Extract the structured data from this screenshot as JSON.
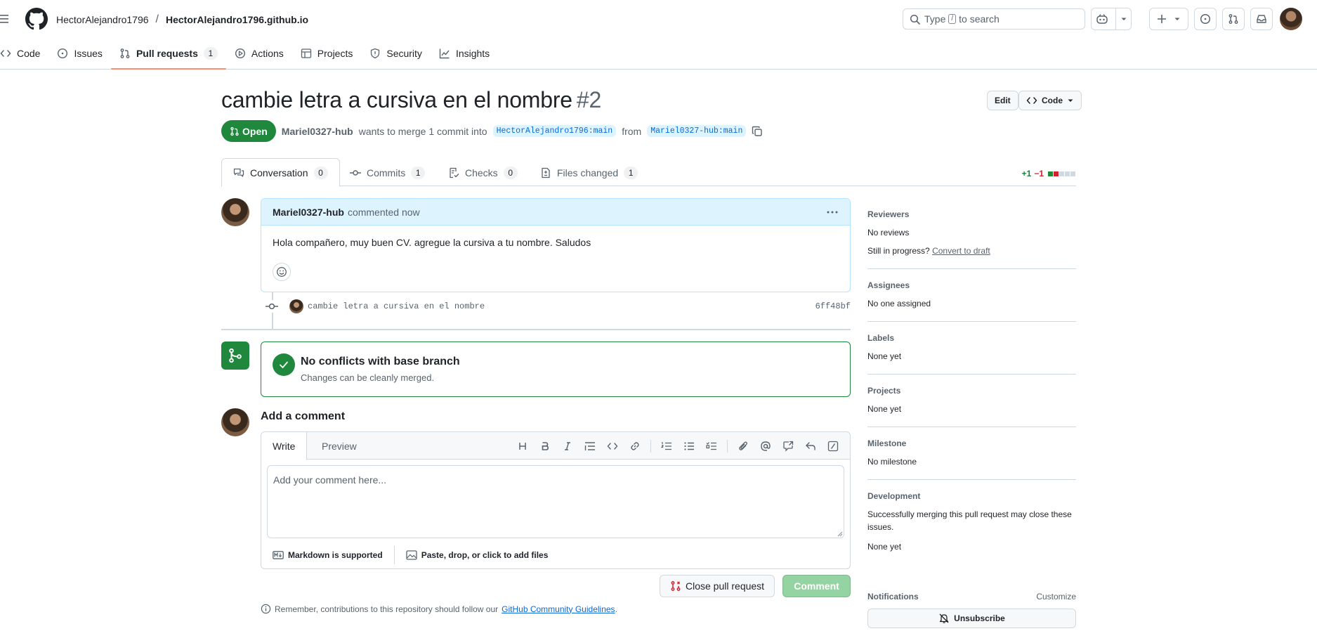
{
  "header": {
    "owner": "HectorAlejandro1796",
    "separator": "/",
    "repo": "HectorAlejandro1796.github.io",
    "search_before": "Type",
    "search_key": "/",
    "search_after": "to search"
  },
  "repo_nav": [
    {
      "label": "Code",
      "icon": "code-icon"
    },
    {
      "label": "Issues",
      "icon": "issue-icon"
    },
    {
      "label": "Pull requests",
      "icon": "pull-request-icon",
      "count": "1",
      "selected": true
    },
    {
      "label": "Actions",
      "icon": "play-icon"
    },
    {
      "label": "Projects",
      "icon": "table-icon"
    },
    {
      "label": "Security",
      "icon": "shield-icon"
    },
    {
      "label": "Insights",
      "icon": "graph-icon"
    }
  ],
  "pr": {
    "title": "cambie letra a cursiva en el nombre",
    "number": "#2",
    "edit_label": "Edit",
    "code_label": "Code",
    "state": "Open",
    "author": "Mariel0327-hub",
    "merge_text": "wants to merge 1 commit into",
    "base_branch": "HectorAlejandro1796:main",
    "from_text": "from",
    "head_branch": "Mariel0327-hub:main"
  },
  "tabs": [
    {
      "label": "Conversation",
      "count": "0"
    },
    {
      "label": "Commits",
      "count": "1"
    },
    {
      "label": "Checks",
      "count": "0"
    },
    {
      "label": "Files changed",
      "count": "1"
    }
  ],
  "diffstat": {
    "additions": "+1",
    "deletions": "−1"
  },
  "comment": {
    "author": "Mariel0327-hub",
    "action": "commented now",
    "body": "Hola compañero, muy buen CV. agregue la cursiva a tu nombre. Saludos"
  },
  "commit": {
    "message": "cambie letra a cursiva en el nombre",
    "sha": "6ff48bf"
  },
  "merge": {
    "title": "No conflicts with base branch",
    "subtitle": "Changes can be cleanly merged."
  },
  "editor": {
    "heading": "Add a comment",
    "write_tab": "Write",
    "preview_tab": "Preview",
    "placeholder": "Add your comment here...",
    "markdown_note": "Markdown is supported",
    "attach_note": "Paste, drop, or click to add files",
    "close_button": "Close pull request",
    "comment_button": "Comment",
    "guidelines_before": "Remember, contributions to this repository should follow our",
    "guidelines_link": "GitHub Community Guidelines",
    "guidelines_after": "."
  },
  "sidebar": {
    "reviewers_heading": "Reviewers",
    "reviewers_value": "No reviews",
    "in_progress": "Still in progress?",
    "convert_draft": "Convert to draft",
    "assignees_heading": "Assignees",
    "assignees_value": "No one assigned",
    "labels_heading": "Labels",
    "labels_value": "None yet",
    "projects_heading": "Projects",
    "projects_value": "None yet",
    "milestone_heading": "Milestone",
    "milestone_value": "No milestone",
    "development_heading": "Development",
    "development_text": "Successfully merging this pull request may close these issues.",
    "development_value": "None yet",
    "notifications_heading": "Notifications",
    "customize_label": "Customize",
    "unsubscribe_label": "Unsubscribe"
  },
  "colors": {
    "open_green": "#1f883d",
    "link_blue": "#0969da",
    "tab_underline": "#fd8c73",
    "deletion_red": "#d1242f"
  }
}
